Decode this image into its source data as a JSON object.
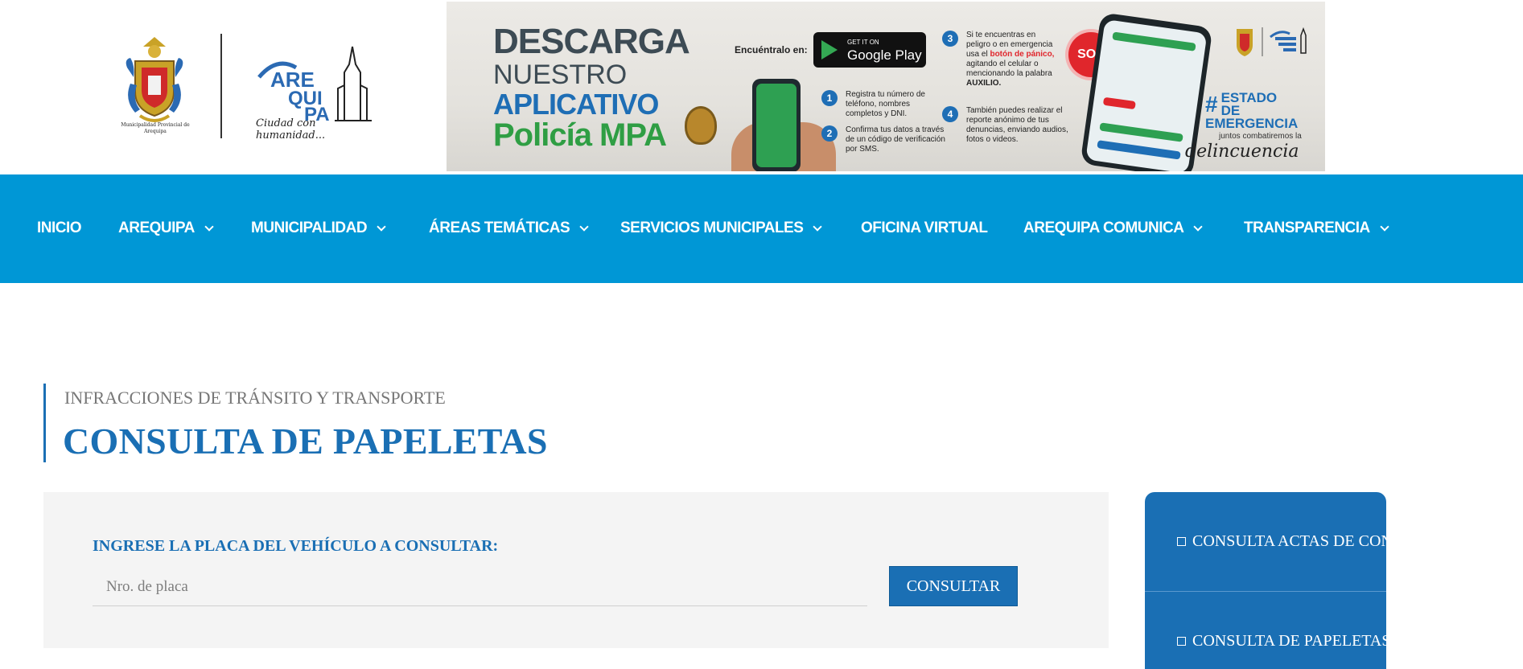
{
  "header": {
    "coat_caption": "Municipalidad Provincial de Arequipa",
    "city_logo_text": "AREQUIPA",
    "city_tagline": "Ciudad con humanidad..."
  },
  "banner": {
    "title_line1": "DESCARGA",
    "title_line2": "NUESTRO",
    "title_line3": "APLICATIVO",
    "title_line4": "Policía MPA",
    "find_label": "Encuéntralo en:",
    "store_small": "GET IT ON",
    "store_big": "Google Play",
    "step1_num": "1",
    "step1_text": "Registra tu número de teléfono, nombres completos y DNI.",
    "step2_num": "2",
    "step2_text": "Confirma tus datos a través de un código de verificación por SMS.",
    "step3_num": "3",
    "step3_text_a": "Si te encuentras en peligro o en emergencia usa el",
    "step3_text_red": "botón de pánico,",
    "step3_text_b": "agitando el celular o mencionando la palabra",
    "step3_text_bold": "AUXILIO.",
    "step4_num": "4",
    "step4_text": "También puedes realizar el reporte anónimo de tus denuncias, enviando audios, fotos o videos.",
    "sos": "SOS",
    "estado_hash": "#",
    "estado_line1": "ESTADO DE",
    "estado_line2": "EMERGENCIA",
    "juntos": "juntos combatiremos la",
    "delincuencia": "delincuencia"
  },
  "nav": {
    "items": [
      {
        "label": "INICIO"
      },
      {
        "label": "AREQUIPA"
      },
      {
        "label": "MUNICIPALIDAD"
      },
      {
        "label": "ÁREAS TEMÁTICAS"
      },
      {
        "label": "SERVICIOS MUNICIPALES"
      },
      {
        "label": "OFICINA VIRTUAL"
      },
      {
        "label": "AREQUIPA COMUNICA"
      },
      {
        "label": "TRANSPARENCIA"
      }
    ]
  },
  "main": {
    "eyebrow": "INFRACCIONES DE TRÁNSITO Y TRANSPORTE",
    "title": "CONSULTA DE PAPELETAS",
    "form": {
      "label": "INGRESE LA PLACA DEL VEHÍCULO A CONSULTAR:",
      "placeholder": "Nro. de placa",
      "value": "",
      "button": "CONSULTAR"
    }
  },
  "sidebar": {
    "items": [
      {
        "label": "CONSULTA ACTAS DE CONTROL"
      },
      {
        "label": "CONSULTA DE PAPELETAS"
      }
    ]
  },
  "colors": {
    "nav_bg": "#0097d6",
    "accent_blue": "#1a6fb4",
    "form_bg": "#f4f4f4"
  }
}
